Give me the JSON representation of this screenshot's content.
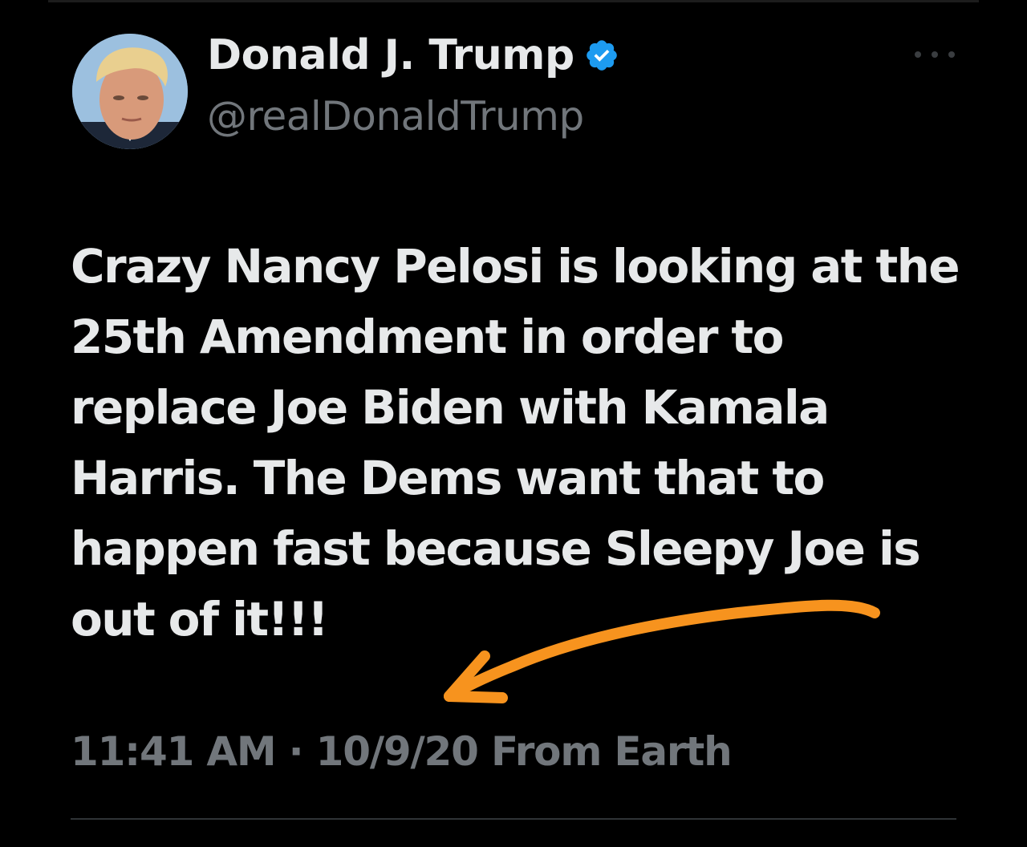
{
  "author": {
    "display_name": "Donald J. Trump",
    "handle": "@realDonaldTrump",
    "verified": true,
    "verified_color": "#1d9bf0"
  },
  "tweet": {
    "text": "Crazy Nancy Pelosi is looking at the 25th Amendment in order to replace Joe Biden with Kamala Harris. The Dems want that to happen fast because Sleepy Joe is out of it!!!",
    "time": "11:41 AM",
    "separator": "·",
    "date": "10/9/20",
    "source": "From Earth"
  },
  "icons": {
    "more": "more-horizontal-icon",
    "verified": "verified-badge-icon",
    "annotation": "orange-arrow-annotation"
  },
  "colors": {
    "background": "#000000",
    "text_primary": "#e7e9ea",
    "text_secondary": "#71767b",
    "annotation_arrow": "#f7931e"
  }
}
